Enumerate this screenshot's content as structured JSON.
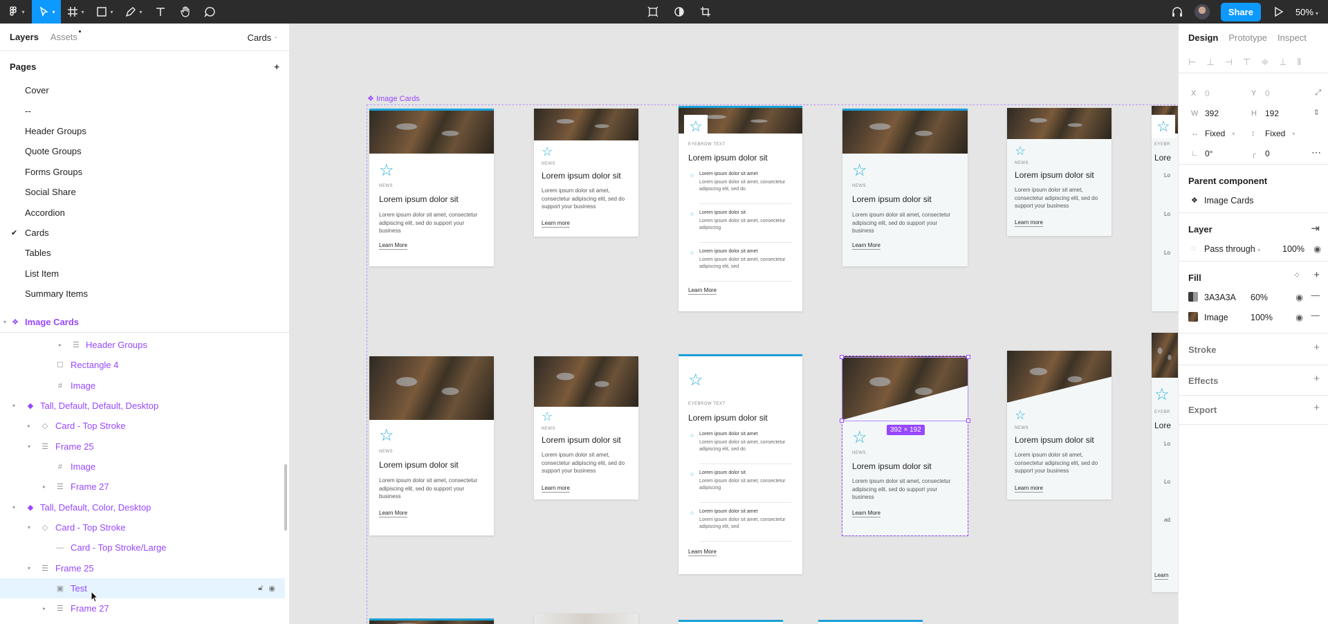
{
  "toolbar": {
    "tools": [
      "figma-menu-icon",
      "move-tool-icon",
      "frame-tool-icon",
      "shape-tool-icon",
      "pen-tool-icon",
      "text-tool-icon",
      "hand-tool-icon",
      "comment-tool-icon"
    ],
    "share_label": "Share",
    "zoom": "50%"
  },
  "left_panel": {
    "tabs": [
      "Layers",
      "Assets"
    ],
    "current_page": "Cards",
    "pages_title": "Pages",
    "pages": [
      "Cover",
      "--",
      "Header Groups",
      "Quote Groups",
      "Forms Groups",
      "Social Share",
      "Accordion",
      "Cards",
      "Tables",
      "List Item",
      "Summary Items"
    ],
    "selected_page": "Cards",
    "layers": [
      {
        "label": "Image Cards"
      },
      {
        "label": "Header Groups"
      },
      {
        "label": "Rectangle 4"
      },
      {
        "label": "Image"
      },
      {
        "label": "Tall, Default, Default, Desktop"
      },
      {
        "label": "Card - Top Stroke"
      },
      {
        "label": "Frame 25"
      },
      {
        "label": "Image"
      },
      {
        "label": "Frame 27"
      },
      {
        "label": "Tall, Default, Color, Desktop"
      },
      {
        "label": "Card - Top Stroke"
      },
      {
        "label": "Card - Top Stroke/Large"
      },
      {
        "label": "Frame 25"
      },
      {
        "label": "Test"
      },
      {
        "label": "Frame 27"
      }
    ]
  },
  "canvas": {
    "frame_label": "Image Cards",
    "eyebrow_news": "NEWS",
    "eyebrow_text": "EYEBROW TEXT",
    "card_title": "Lorem ipsum dolor sit",
    "card_body": "Lorem ipsum dolor sit amet, consectetur adipiscing elit, sed do support your business",
    "learn_more_a": "Learn More",
    "learn_more_b": "Learn more",
    "list_title_a": "Lorem ipsum dolor sit amet",
    "list_desc_a": "Lorem ipsum dolor sit amet, consectetur adipiscing elit, sed do",
    "list_title_b": "Lorem ipsum dolor sit",
    "list_desc_b": "Lorem ipsum dolor sit amet, consectetur adipiscing",
    "list_desc_c": "Lorem ipsum dolor sit amet, consectetur adipiscing elit, sed",
    "dimension_badge": "392 × 192",
    "partial_title": "Lore",
    "partial_lo": "Lo",
    "partial_ad": "ad",
    "partial_learn": "Learn",
    "partial_eyebrow": "EYEBR"
  },
  "right_panel": {
    "tabs": [
      "Design",
      "Prototype",
      "Inspect"
    ],
    "x": "0",
    "y": "0",
    "w": "392",
    "h": "192",
    "x_label": "X",
    "y_label": "Y",
    "w_label": "W",
    "h_label": "H",
    "resize_w": "Fixed",
    "resize_h": "Fixed",
    "rotation": "0°",
    "radius": "0",
    "parent_component_title": "Parent component",
    "parent_component": "Image Cards",
    "layer_title": "Layer",
    "blend_mode": "Pass through",
    "layer_opacity": "100%",
    "fill_title": "Fill",
    "fills": [
      {
        "name": "3A3A3A",
        "opacity": "60%",
        "color": "#3A3A3A"
      },
      {
        "name": "Image",
        "opacity": "100%"
      }
    ],
    "stroke_title": "Stroke",
    "effects_title": "Effects",
    "export_title": "Export"
  },
  "colors": {
    "accent": "#0d99ff",
    "component": "#9747ff",
    "card_accent": "#18a0d8"
  }
}
